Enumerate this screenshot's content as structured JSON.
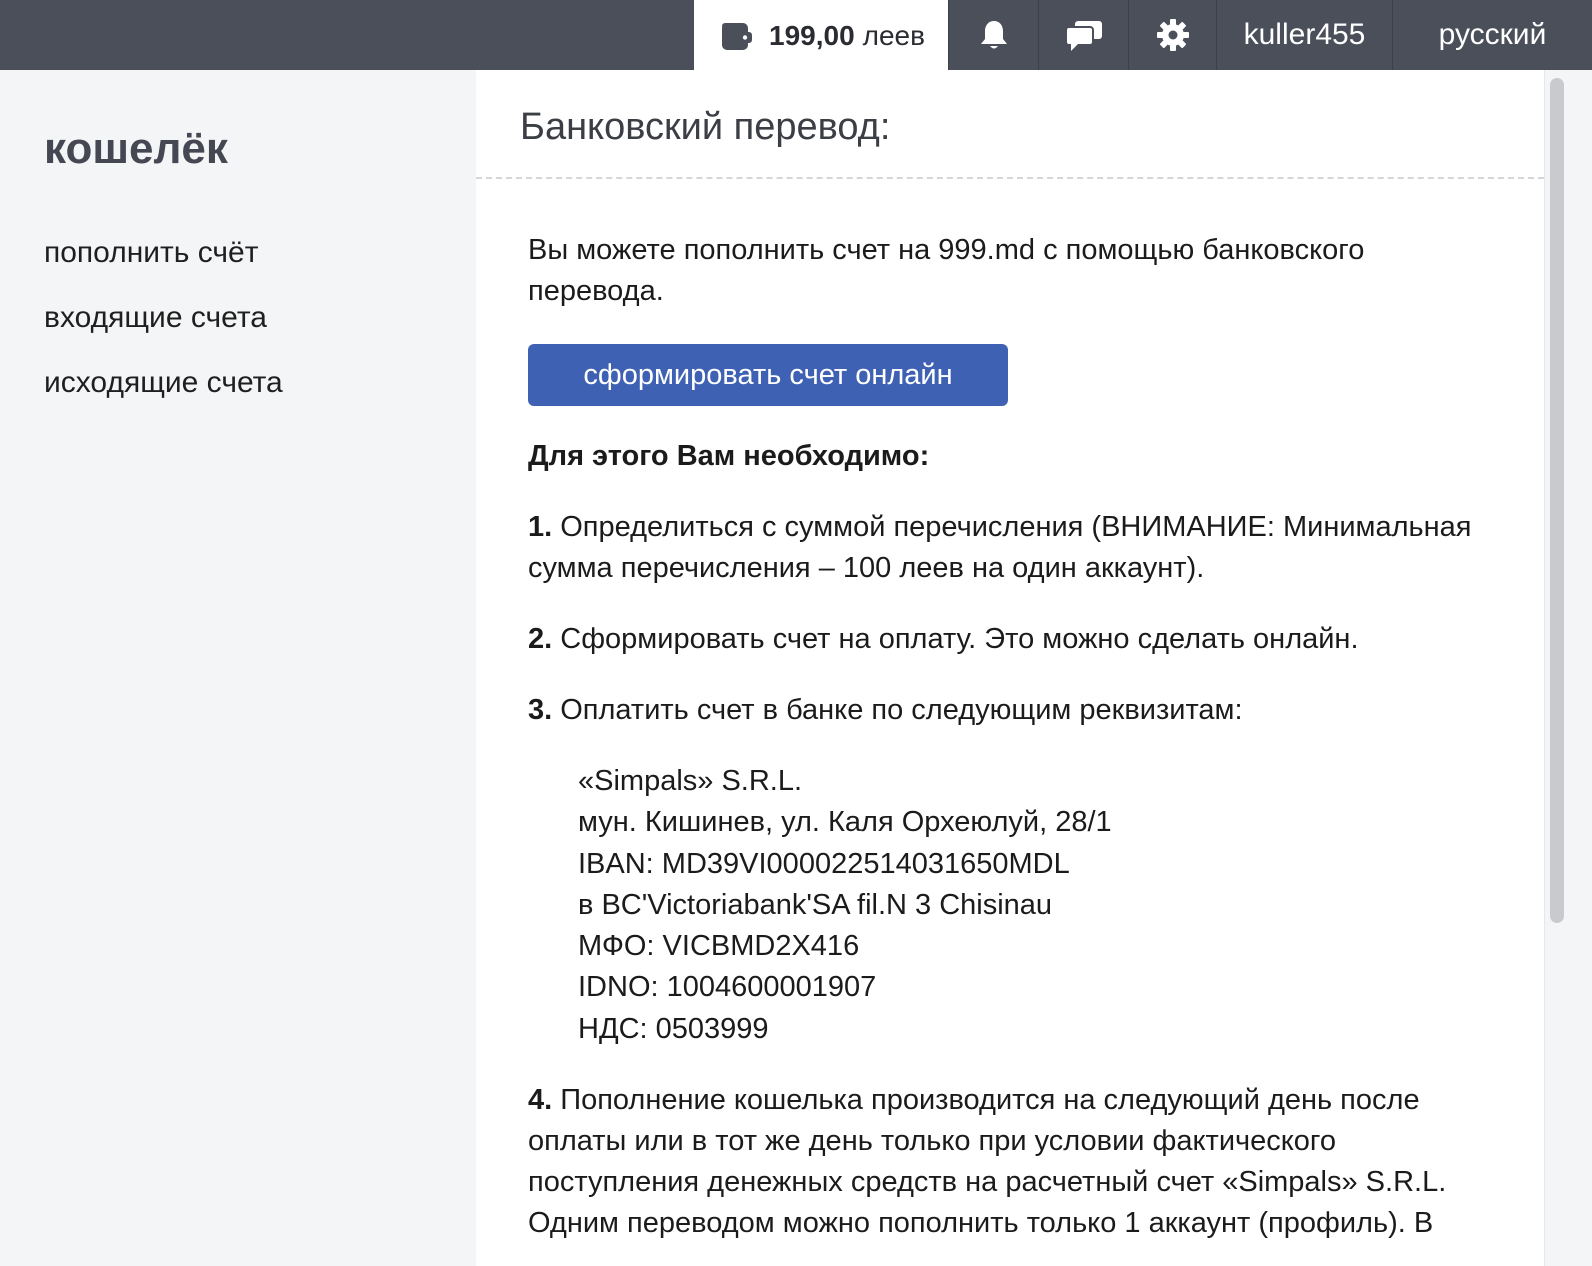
{
  "topbar": {
    "wallet": {
      "amount": "199,00",
      "currency": "леев",
      "icon": "wallet-icon"
    },
    "icons": [
      "bell-icon",
      "chat-icon",
      "gear-icon"
    ],
    "username": "kuller455",
    "language": "русский"
  },
  "sidebar": {
    "title": "кошелёк",
    "items": [
      {
        "label": "пополнить счёт"
      },
      {
        "label": "входящие счета"
      },
      {
        "label": "исходящие счета"
      }
    ]
  },
  "main": {
    "title": "Банковский перевод:",
    "intro": "Вы можете пополнить счет на 999.md с помощью банковского перевода.",
    "button_label": "сформировать счет онлайн",
    "need_heading": "Для этого Вам необходимо:",
    "steps": [
      {
        "num": "1.",
        "text": " Определиться с суммой перечисления (ВНИМАНИЕ: Минимальная сумма перечисления – 100 леев на один аккаунт)."
      },
      {
        "num": "2.",
        "text": " Сформировать счет на оплату. Это можно сделать онлайн."
      },
      {
        "num": "3.",
        "text": " Оплатить счет в банке по следующим реквизитам:"
      },
      {
        "num": "4.",
        "text": " Пополнение кошелька производится на следующий день после оплаты или в тот же день только при условии фактического поступления денежных средств на расчетный счет «Simpals» S.R.L. Одним переводом можно пополнить только 1 аккаунт (профиль). В"
      }
    ],
    "requisites": [
      "«Simpals» S.R.L.",
      "мун. Кишинев, ул. Каля Орхеюлуй, 28/1",
      "IBAN: MD39VI000022514031650MDL",
      "в BC'Victoriabank'SA fil.N 3 Chisinau",
      "МФО: VICBMD2X416",
      "IDNO: 1004600001907",
      "НДС: 0503999"
    ]
  },
  "colors": {
    "topbar_bg": "#4a4f5a",
    "sidebar_bg": "#f4f5f7",
    "button_bg": "#3f61b3"
  }
}
